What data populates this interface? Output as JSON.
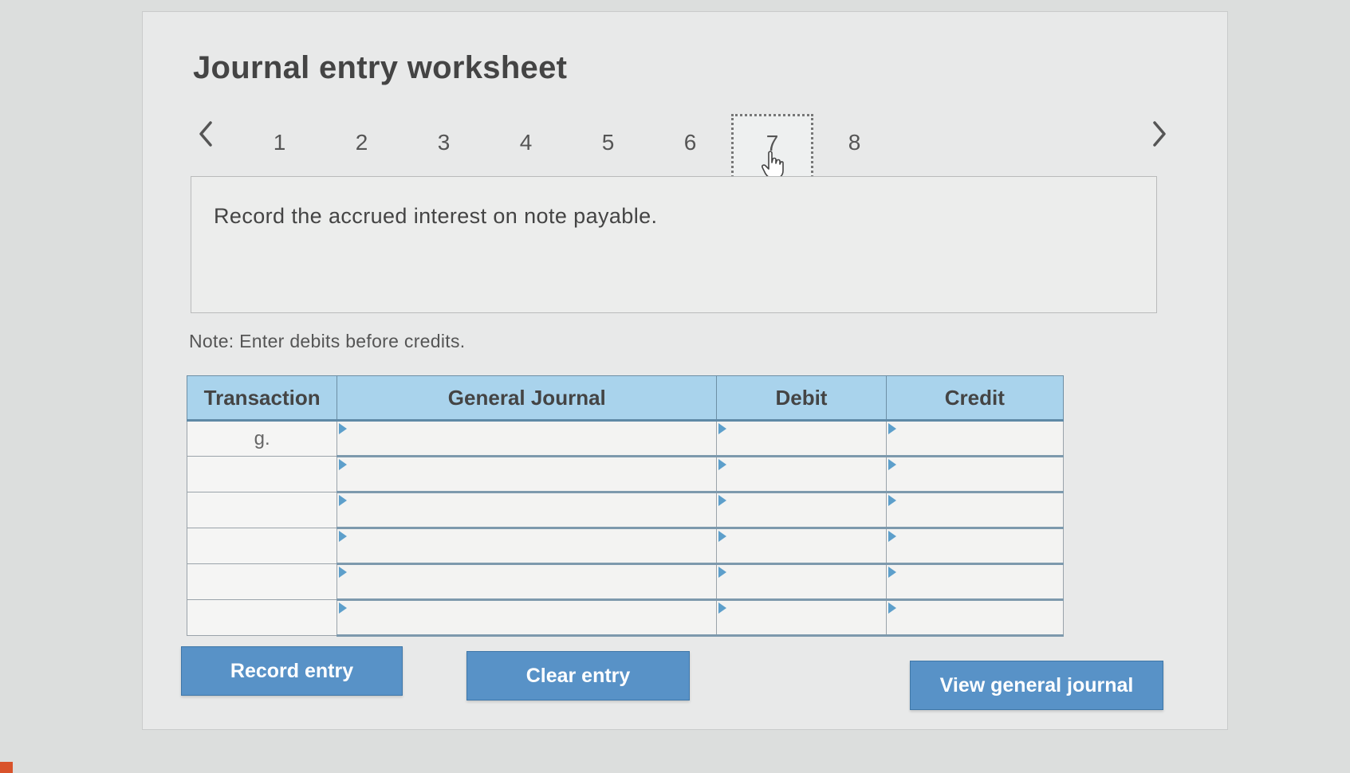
{
  "title": "Journal entry worksheet",
  "pagination": {
    "pages": [
      "1",
      "2",
      "3",
      "4",
      "5",
      "6",
      "7",
      "8"
    ],
    "active": "7"
  },
  "prompt": "Record the accrued interest on note payable.",
  "note": "Note: Enter debits before credits.",
  "table": {
    "headers": {
      "transaction": "Transaction",
      "general_journal": "General Journal",
      "debit": "Debit",
      "credit": "Credit"
    },
    "rows": [
      {
        "transaction": "g.",
        "account": "",
        "debit": "",
        "credit": ""
      },
      {
        "transaction": "",
        "account": "",
        "debit": "",
        "credit": ""
      },
      {
        "transaction": "",
        "account": "",
        "debit": "",
        "credit": ""
      },
      {
        "transaction": "",
        "account": "",
        "debit": "",
        "credit": ""
      },
      {
        "transaction": "",
        "account": "",
        "debit": "",
        "credit": ""
      },
      {
        "transaction": "",
        "account": "",
        "debit": "",
        "credit": ""
      }
    ]
  },
  "buttons": {
    "record": "Record entry",
    "clear": "Clear entry",
    "view": "View general journal"
  },
  "icons": {
    "prev": "chevron-left-icon",
    "next": "chevron-right-icon",
    "cursor": "hand-pointer-icon",
    "cell_flag": "triangle-flag-icon"
  },
  "colors": {
    "header_bg": "#a9d3ec",
    "button_bg": "#5892c7"
  }
}
